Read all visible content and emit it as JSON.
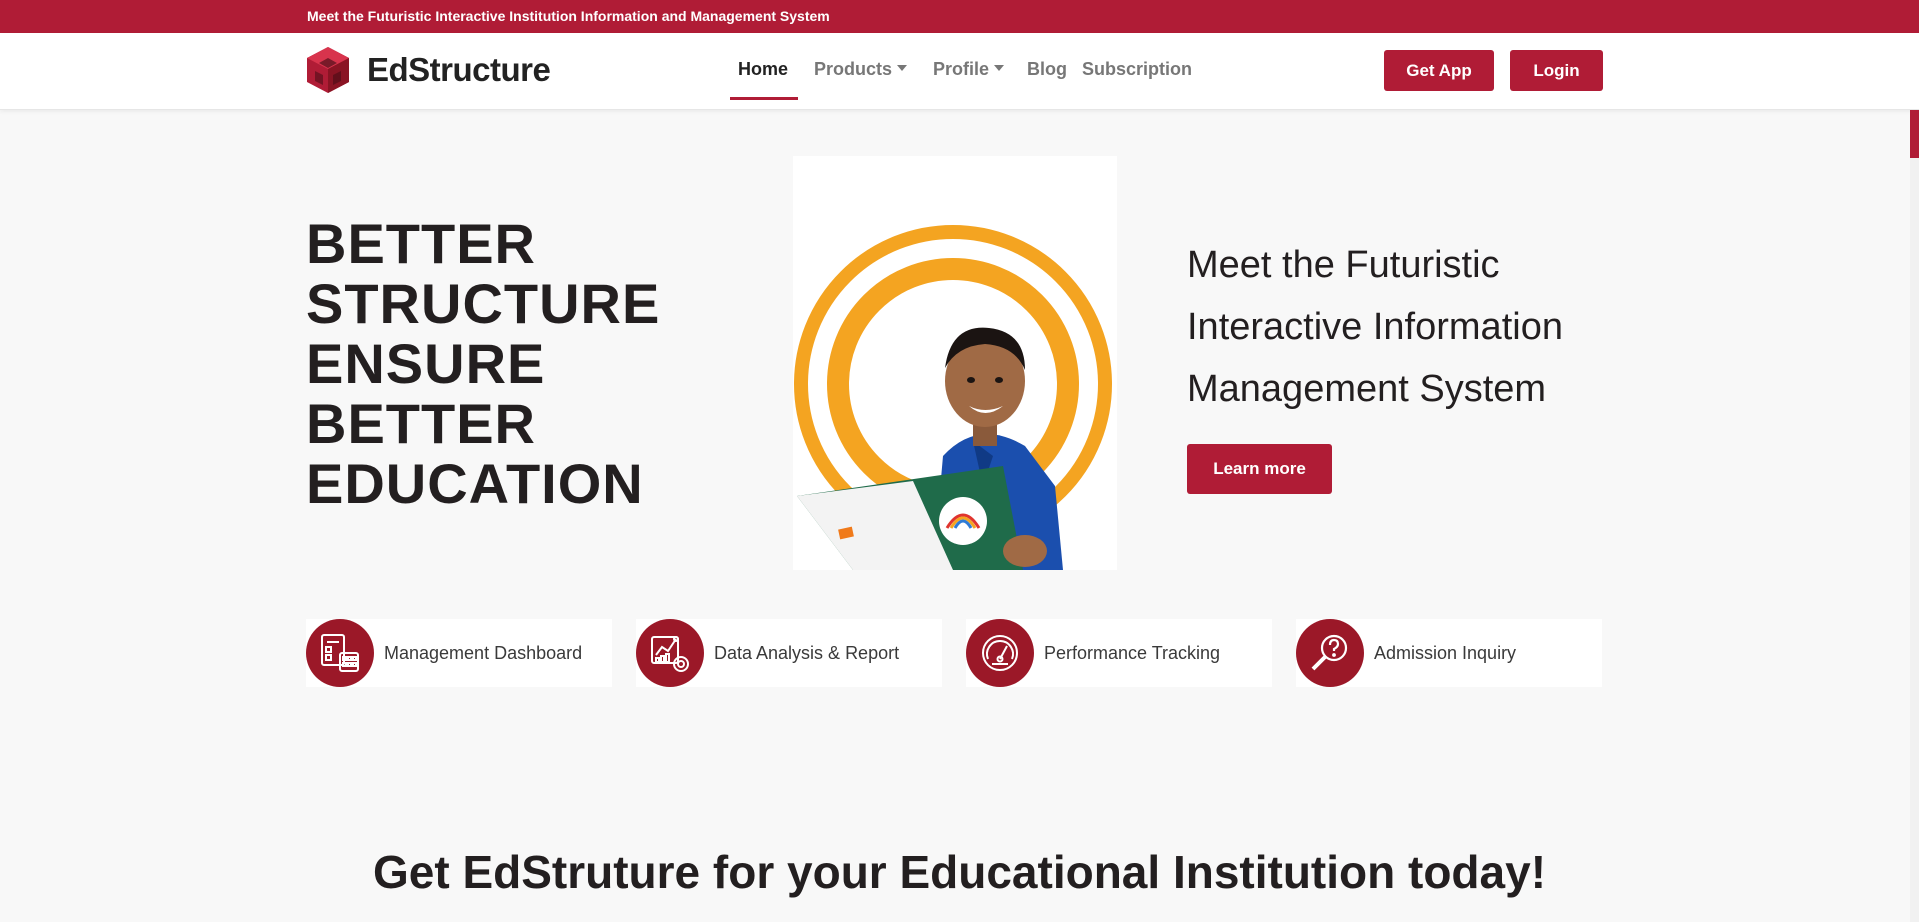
{
  "topbar": {
    "announcement": "Meet the Futuristic Interactive Institution Information and Management System"
  },
  "brand": {
    "name": "EdStructure",
    "logo_icon": "cube-logo-icon"
  },
  "nav": {
    "items": [
      {
        "label": "Home",
        "active": true
      },
      {
        "label": "Products",
        "dropdown": true
      },
      {
        "label": "Profile",
        "dropdown": true
      },
      {
        "label": "Blog"
      },
      {
        "label": "Subscription"
      }
    ],
    "get_app_label": "Get App",
    "login_label": "Login"
  },
  "hero": {
    "title_lines": [
      "BETTER",
      "STRUCTURE",
      "ENSURE",
      "BETTER",
      "EDUCATION"
    ],
    "subtitle_lines": [
      "Meet the Futuristic",
      "Interactive Information",
      "Management System"
    ],
    "learn_more_label": "Learn more",
    "image_icon": "student-with-book-image"
  },
  "features": [
    {
      "label": "Management Dashboard",
      "icon": "dashboard-icon"
    },
    {
      "label": "Data Analysis & Report",
      "icon": "analytics-icon"
    },
    {
      "label": "Performance Tracking",
      "icon": "speedometer-icon"
    },
    {
      "label": "Admission Inquiry",
      "icon": "inquiry-search-icon"
    }
  ],
  "cta": {
    "heading": "Get EdStruture for your Educational Institution today!"
  },
  "colors": {
    "brand": "#b01c36",
    "feature_icon_bg": "#9b1828",
    "ring": "#f4a421",
    "text_dark": "#231f20"
  }
}
